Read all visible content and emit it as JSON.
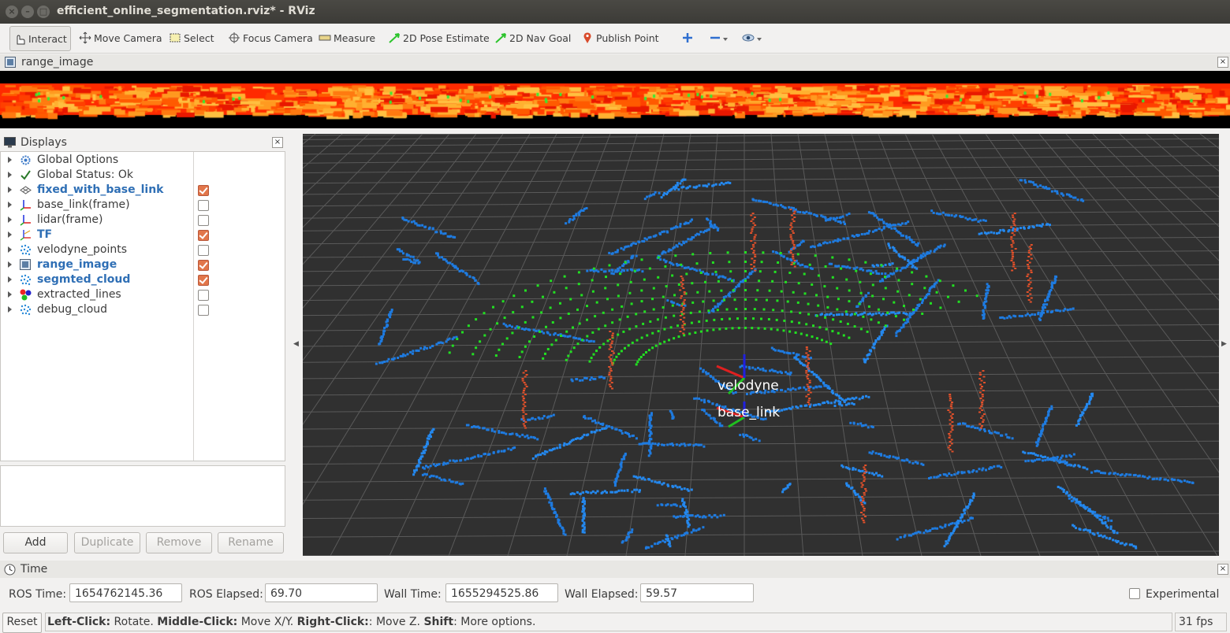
{
  "window": {
    "title": "efficient_online_segmentation.rviz* - RViz"
  },
  "toolbar": {
    "tools": [
      {
        "label": "Interact",
        "icon": "hand-icon"
      },
      {
        "label": "Move Camera",
        "icon": "move-camera-icon"
      },
      {
        "label": "Select",
        "icon": "select-icon"
      },
      {
        "label": "Focus Camera",
        "icon": "focus-camera-icon"
      },
      {
        "label": "Measure",
        "icon": "ruler-icon"
      },
      {
        "label": "2D Pose Estimate",
        "icon": "pose-estimate-icon"
      },
      {
        "label": "2D Nav Goal",
        "icon": "nav-goal-icon"
      },
      {
        "label": "Publish Point",
        "icon": "map-pin-icon"
      }
    ]
  },
  "range_panel": {
    "title": "range_image"
  },
  "displays": {
    "title": "Displays",
    "items": [
      {
        "label": "Global Options",
        "checkbox": null,
        "highlight": false,
        "icon": "gear-icon"
      },
      {
        "label": "Global Status: Ok",
        "checkbox": null,
        "highlight": false,
        "icon": "check-icon"
      },
      {
        "label": "fixed_with_base_link",
        "checkbox": true,
        "highlight": true,
        "icon": "grid-icon"
      },
      {
        "label": "base_link(frame)",
        "checkbox": false,
        "highlight": false,
        "icon": "axes-icon"
      },
      {
        "label": "lidar(frame)",
        "checkbox": false,
        "highlight": false,
        "icon": "axes-icon"
      },
      {
        "label": "TF",
        "checkbox": true,
        "highlight": true,
        "icon": "tf-icon"
      },
      {
        "label": "velodyne_points",
        "checkbox": false,
        "highlight": false,
        "icon": "pointcloud-icon"
      },
      {
        "label": "range_image",
        "checkbox": true,
        "highlight": true,
        "icon": "image-icon"
      },
      {
        "label": "segmted_cloud",
        "checkbox": true,
        "highlight": true,
        "icon": "pointcloud-icon"
      },
      {
        "label": "extracted_lines",
        "checkbox": false,
        "highlight": false,
        "icon": "marker-icon"
      },
      {
        "label": "debug_cloud",
        "checkbox": false,
        "highlight": false,
        "icon": "pointcloud-icon"
      }
    ],
    "buttons": {
      "add": "Add",
      "duplicate": "Duplicate",
      "remove": "Remove",
      "rename": "Rename"
    }
  },
  "viewport": {
    "frame_labels": [
      "velodyne",
      "base_link"
    ]
  },
  "time": {
    "title": "Time",
    "ros_time_label": "ROS Time:",
    "ros_time": "1654762145.36",
    "ros_elapsed_label": "ROS Elapsed:",
    "ros_elapsed": "69.70",
    "wall_time_label": "Wall Time:",
    "wall_time": "1655294525.86",
    "wall_elapsed_label": "Wall Elapsed:",
    "wall_elapsed": "59.57",
    "experimental_label": "Experimental"
  },
  "status": {
    "reset": "Reset",
    "hint": [
      {
        "b": "Left-Click:",
        "t": " Rotate. "
      },
      {
        "b": "Middle-Click:",
        "t": " Move X/Y. "
      },
      {
        "b": "Right-Click:",
        "t": ": Move Z. "
      },
      {
        "b": "Shift",
        "t": ": More options."
      }
    ],
    "fps": "31 fps"
  },
  "colors": {
    "accent": "#2f6fb5",
    "view_bg": "#303030",
    "grid": "#5a5a5a",
    "cloud_blue": "#1e7be0",
    "cloud_green": "#22e022",
    "cloud_red": "#e0502a",
    "range_red": "#ff2a00"
  }
}
